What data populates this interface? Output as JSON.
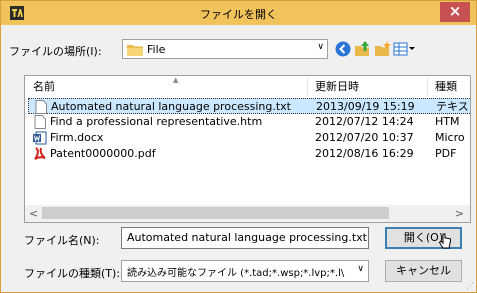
{
  "window": {
    "title": "ファイルを開く",
    "close": "×"
  },
  "location": {
    "label": "ファイルの場所(I):",
    "value": "File"
  },
  "columns": {
    "name": "名前",
    "date": "更新日時",
    "type": "種類"
  },
  "files": [
    {
      "name": "Automated natural language processing.txt",
      "date": "2013/09/19 15:19",
      "type": "テキス",
      "icon": "text-file-icon",
      "selected": true
    },
    {
      "name": "Find a professional representative.htm",
      "date": "2012/07/12 14:24",
      "type": "HTM",
      "icon": "html-file-icon",
      "selected": false
    },
    {
      "name": "Firm.docx",
      "date": "2012/07/20 10:37",
      "type": "Micro",
      "icon": "word-doc-icon",
      "selected": false
    },
    {
      "name": "Patent0000000.pdf",
      "date": "2012/08/16 16:29",
      "type": "PDF",
      "icon": "pdf-file-icon",
      "selected": false
    }
  ],
  "filename": {
    "label": "ファイル名(N):",
    "value": "Automated natural language processing.txt"
  },
  "filetype": {
    "label": "ファイルの種類(T):",
    "value": "読み込み可能なファイル (*.tad;*.wsp;*.lvp;*.l\\"
  },
  "buttons": {
    "open": "開く(O)",
    "cancel": "キャンセル"
  },
  "colors": {
    "titlebar": "#f0c45a",
    "close": "#c75050",
    "selection": "#cce8ff",
    "default_button_border": "#3c7fb1"
  }
}
